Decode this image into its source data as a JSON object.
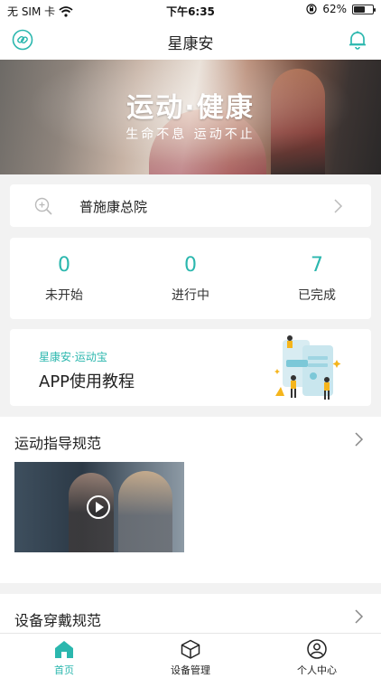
{
  "status_bar": {
    "carrier": "无 SIM 卡",
    "time": "下午6:35",
    "battery_percent": "62%",
    "battery_level": 0.62
  },
  "nav": {
    "title": "星康安",
    "left_icon": "link-icon",
    "right_icon": "bell-icon"
  },
  "banner": {
    "title": "运动·健康",
    "subtitle": "生命不息 运动不止",
    "slide_count": 2,
    "active_slide": 2
  },
  "hospital": {
    "name": "普施康总院"
  },
  "stats": [
    {
      "value": "0",
      "label": "未开始"
    },
    {
      "value": "0",
      "label": "进行中"
    },
    {
      "value": "7",
      "label": "已完成"
    }
  ],
  "tutorial": {
    "subtitle": "星康安·运动宝",
    "title": "APP使用教程"
  },
  "sections": [
    {
      "title": "运动指导规范"
    },
    {
      "title": "设备穿戴规范"
    }
  ],
  "tabs": [
    {
      "label": "首页",
      "icon": "home-icon",
      "active": true
    },
    {
      "label": "设备管理",
      "icon": "cube-icon",
      "active": false
    },
    {
      "label": "个人中心",
      "icon": "user-icon",
      "active": false
    }
  ],
  "colors": {
    "accent": "#2bb7ae",
    "tutorial_accent": "#f5b51c"
  }
}
